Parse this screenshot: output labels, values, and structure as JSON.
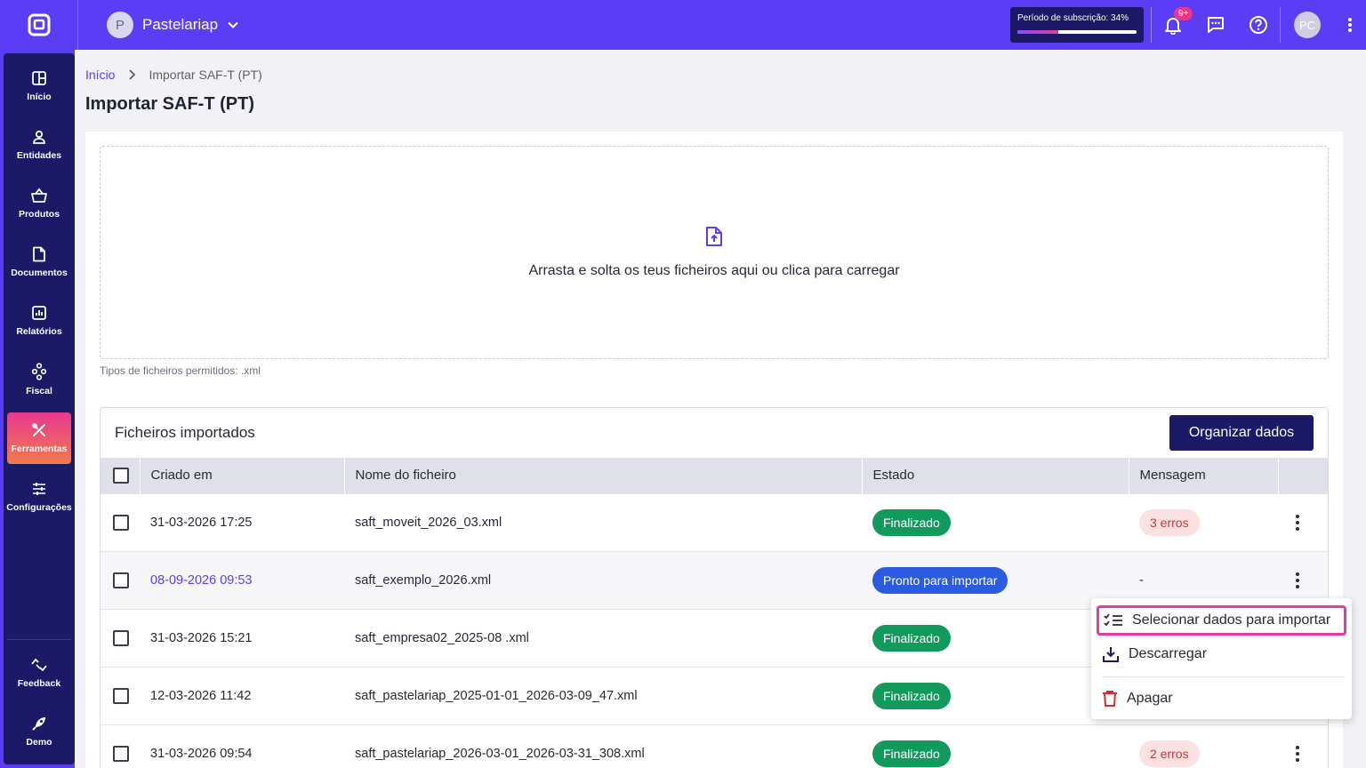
{
  "header": {
    "company_initial": "P",
    "company_name": "Pastelariap",
    "subscription_label": "Período de subscrição: 34%",
    "subscription_progress": 0.34,
    "notifications_badge": "9+",
    "user_initials": "PC"
  },
  "sidebar": {
    "items": [
      {
        "label": "Início",
        "icon": "dashboard-icon"
      },
      {
        "label": "Entidades",
        "icon": "person-icon"
      },
      {
        "label": "Produtos",
        "icon": "basket-icon"
      },
      {
        "label": "Documentos",
        "icon": "document-icon"
      },
      {
        "label": "Relatórios",
        "icon": "chart-icon"
      },
      {
        "label": "Fiscal",
        "icon": "hierarchy-icon"
      },
      {
        "label": "Ferramentas",
        "icon": "tools-icon"
      },
      {
        "label": "Configurações",
        "icon": "sliders-icon"
      }
    ],
    "bottom": [
      {
        "label": "Feedback",
        "icon": "feedback-icon"
      },
      {
        "label": "Demo",
        "icon": "rocket-icon"
      }
    ]
  },
  "breadcrumb": {
    "home": "Início",
    "current": "Importar SAF-T (PT)"
  },
  "page_title": "Importar SAF-T (PT)",
  "dropzone": {
    "text": "Arrasta e solta os teus ficheiros aqui ou clica para carregar"
  },
  "allowed_types": "Tipos de ficheiros permitidos: .xml",
  "files": {
    "title": "Ficheiros importados",
    "organize_button": "Organizar dados",
    "columns": [
      "Criado em",
      "Nome do ficheiro",
      "Estado",
      "Mensagem"
    ],
    "rows": [
      {
        "created": "31-03-2026 17:25",
        "name": "saft_moveit_2026_03.xml",
        "status": "Finalizado",
        "message": "3 erros"
      },
      {
        "created": "08-09-2026 09:53",
        "name": "saft_exemplo_2026.xml",
        "status": "Pronto para importar",
        "message": "-"
      },
      {
        "created": "31-03-2026 15:21",
        "name": "saft_empresa02_2025-08 .xml",
        "status": "Finalizado",
        "message": ""
      },
      {
        "created": "12-03-2026 11:42",
        "name": "saft_pastelariap_2025-01-01_2026-03-09_47.xml",
        "status": "Finalizado",
        "message": ""
      },
      {
        "created": "31-03-2026 09:54",
        "name": "saft_pastelariap_2026-03-01_2026-03-31_308.xml",
        "status": "Finalizado",
        "message": "2 erros"
      }
    ]
  },
  "context_menu": {
    "select": "Selecionar dados para importar",
    "download": "Descarregar",
    "delete": "Apagar"
  },
  "colors": {
    "brand": "#5b3df5",
    "navy": "#1c1a66",
    "success": "#119a5b",
    "info": "#2a5be0",
    "accent": "#e639a8"
  }
}
